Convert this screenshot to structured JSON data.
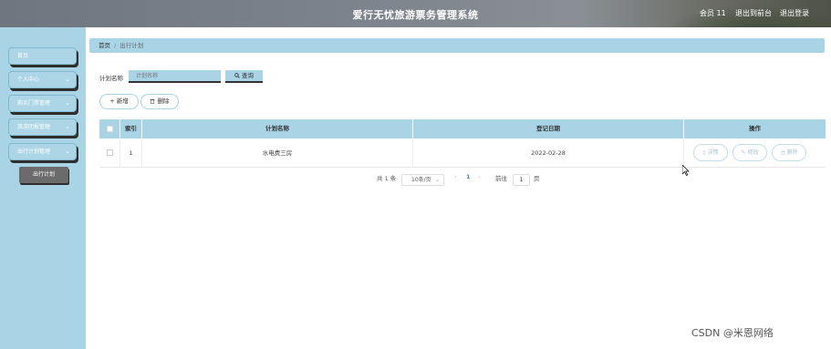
{
  "header": {
    "title": "爱行无忧旅游票务管理系统",
    "user_label": "会员 11",
    "back_label": "退出到前台",
    "logout_label": "退出登录"
  },
  "sidebar": {
    "items": [
      {
        "label": "首页",
        "has_chevron": false
      },
      {
        "label": "个人中心",
        "has_chevron": true
      },
      {
        "label": "购买门票管理",
        "has_chevron": true
      },
      {
        "label": "旅游团报管理",
        "has_chevron": true
      },
      {
        "label": "出行计划管理",
        "has_chevron": true
      }
    ],
    "active_submenu": "出行计划"
  },
  "breadcrumb": {
    "home": "首页",
    "separator": "/",
    "current": "出行计划"
  },
  "search": {
    "label": "计划名称",
    "placeholder": "计划名称",
    "button_label": "查询",
    "button_icon": "search-icon"
  },
  "actions": {
    "add_label": "新增",
    "add_icon": "plus-icon",
    "delete_label": "删除",
    "delete_icon": "trash-icon"
  },
  "table": {
    "columns": [
      "索引",
      "计划名称",
      "登记日期",
      "操作"
    ],
    "rows": [
      {
        "index": "1",
        "plan_name": "水电费三房",
        "date": "2022-02-28"
      }
    ],
    "row_actions": [
      {
        "label": "详情",
        "icon": "document-icon"
      },
      {
        "label": "修改",
        "icon": "edit-icon"
      },
      {
        "label": "删除",
        "icon": "trash-icon"
      }
    ]
  },
  "pagination": {
    "total": "共 1 条",
    "page_size": "10条/页",
    "prev": "‹",
    "current_page": "1",
    "next": "›",
    "goto_label": "前往",
    "goto_value": "1",
    "page_unit": "页"
  },
  "colors": {
    "accent": "#a8d4e6",
    "header_bg": "#7a8189",
    "submenu_bg": "#6b6b6b"
  },
  "watermark": "CSDN @米恩网络"
}
